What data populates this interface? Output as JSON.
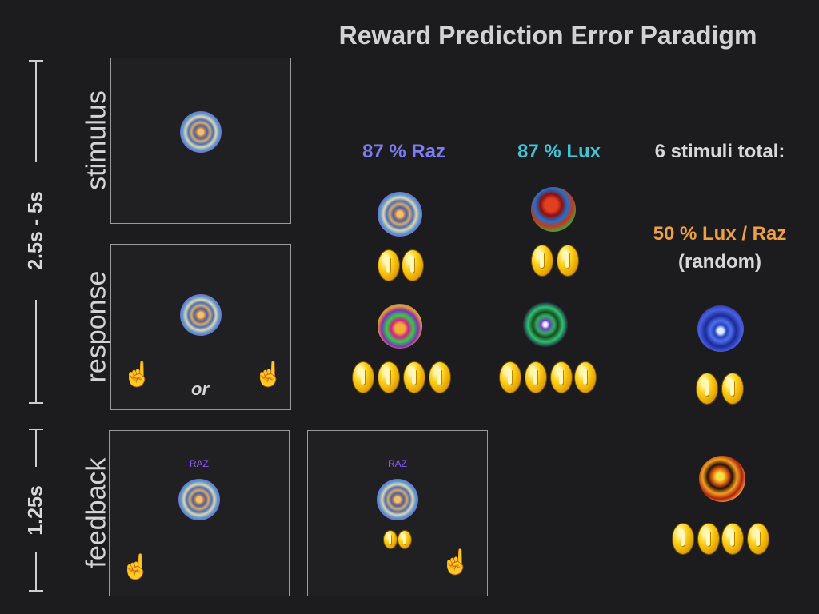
{
  "title": "Reward Prediction Error Paradigm",
  "timing": {
    "trial_window": "2.5s - 5s",
    "feedback_window": "1.25s"
  },
  "phases": {
    "stimulus": "stimulus",
    "response": "response",
    "feedback": "feedback"
  },
  "response_or": "or",
  "feedback_label": "RAZ",
  "conditions": {
    "raz": {
      "label": "87 % Raz",
      "color": "#7c7cf4",
      "top_coins": 2,
      "bottom_coins": 4
    },
    "lux": {
      "label": "87 % Lux",
      "color": "#3fc4d6",
      "top_coins": 2,
      "bottom_coins": 4
    }
  },
  "summary": {
    "total": "6 stimuli total:",
    "random_label": "50 % Lux / Raz",
    "random_color": "#f0a040",
    "random_note": "(random)",
    "top_coins": 2,
    "bottom_coins": 4
  },
  "icons": {
    "hand": "pointing-hand-icon",
    "coin": "gold-coin-icon",
    "stimulus": "fractal-stimulus-icon"
  }
}
